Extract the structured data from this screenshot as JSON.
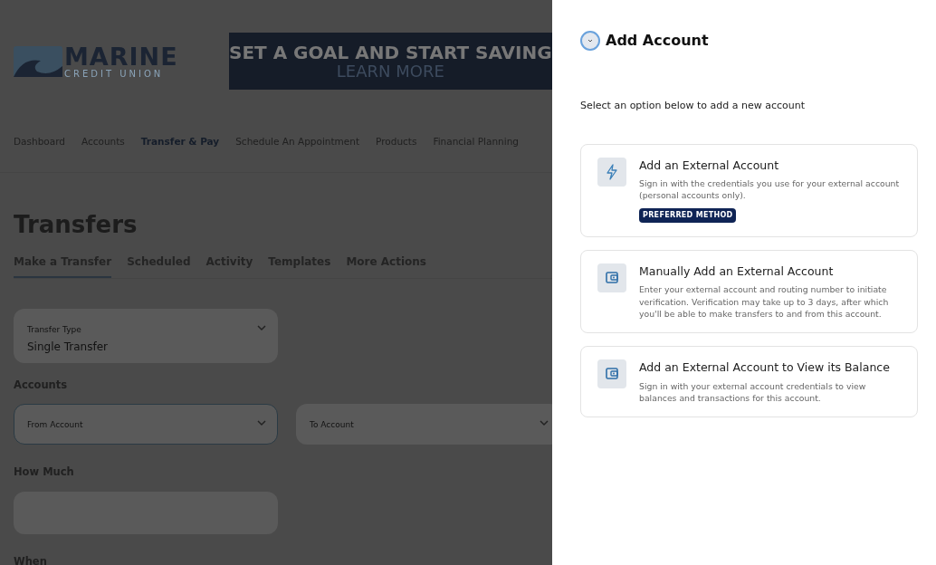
{
  "logo": {
    "name": "MARINE",
    "subtitle": "CREDIT UNION"
  },
  "banner": {
    "headline": "SET A GOAL AND START SAVING",
    "link": "LEARN MORE"
  },
  "nav": [
    {
      "label": "Dashboard",
      "selected": false
    },
    {
      "label": "Accounts",
      "selected": false
    },
    {
      "label": "Transfer & Pay",
      "selected": true
    },
    {
      "label": "Schedule An Appointment",
      "selected": false
    },
    {
      "label": "Products",
      "selected": false
    },
    {
      "label": "Financial Planning",
      "selected": false
    }
  ],
  "page_title": "Transfers",
  "tabs": [
    {
      "label": "Make a Transfer",
      "selected": true
    },
    {
      "label": "Scheduled",
      "selected": false
    },
    {
      "label": "Activity",
      "selected": false
    },
    {
      "label": "Templates",
      "selected": false
    },
    {
      "label": "More Actions",
      "selected": false
    }
  ],
  "form": {
    "transfer_type": {
      "label": "Transfer Type",
      "value": "Single Transfer"
    },
    "accounts_label": "Accounts",
    "from_account": {
      "label": "From Account",
      "focused": true
    },
    "to_account": {
      "label": "To Account",
      "focused": false
    },
    "how_much_label": "How Much",
    "when_label": "When"
  },
  "drawer": {
    "title": "Add Account",
    "intro": "Select an option below to add a new account",
    "options": [
      {
        "kind": "bolt",
        "title": "Add an External Account",
        "description": "Sign in with the credentials you use for your external account (personal accounts only).",
        "badge": "PREFERRED METHOD"
      },
      {
        "kind": "wallet",
        "title": "Manually Add an External Account",
        "description": "Enter your external account and routing number to initiate verification. Verification may take up to 3 days, after which you'll be able to make transfers to and from this account."
      },
      {
        "kind": "wallet",
        "title": "Add an External Account to View its Balance",
        "description": "Sign in with your external account credentials to view balances and transactions for this account."
      }
    ]
  }
}
